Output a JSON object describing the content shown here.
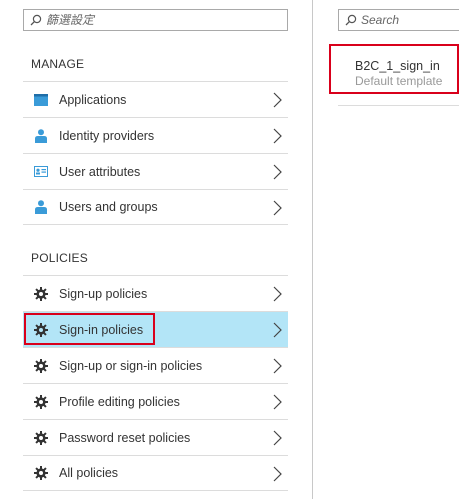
{
  "left_blade": {
    "search_placeholder": "篩選設定",
    "sections": {
      "manage_title": "MANAGE",
      "policies_title": "POLICIES"
    },
    "manage_items": [
      {
        "label": "Applications",
        "icon": "applications-icon"
      },
      {
        "label": "Identity providers",
        "icon": "identity-user-icon"
      },
      {
        "label": "User attributes",
        "icon": "id-card-icon"
      },
      {
        "label": "Users and groups",
        "icon": "user-icon"
      }
    ],
    "policy_items": [
      {
        "label": "Sign-up policies",
        "icon": "gear-icon"
      },
      {
        "label": "Sign-in policies",
        "icon": "gear-icon",
        "selected": true
      },
      {
        "label": "Sign-up or sign-in policies",
        "icon": "gear-icon"
      },
      {
        "label": "Profile editing policies",
        "icon": "gear-icon"
      },
      {
        "label": "Password reset policies",
        "icon": "gear-icon"
      },
      {
        "label": "All policies",
        "icon": "gear-icon"
      }
    ]
  },
  "right_blade": {
    "search_placeholder": "Search",
    "policy": {
      "name": "B2C_1_sign_in",
      "subtitle": "Default template"
    }
  },
  "colors": {
    "selected_row": "#b3e5f7",
    "highlight": "#d9001b",
    "icon_blue": "#3a9bd8",
    "gear": "#333333"
  }
}
